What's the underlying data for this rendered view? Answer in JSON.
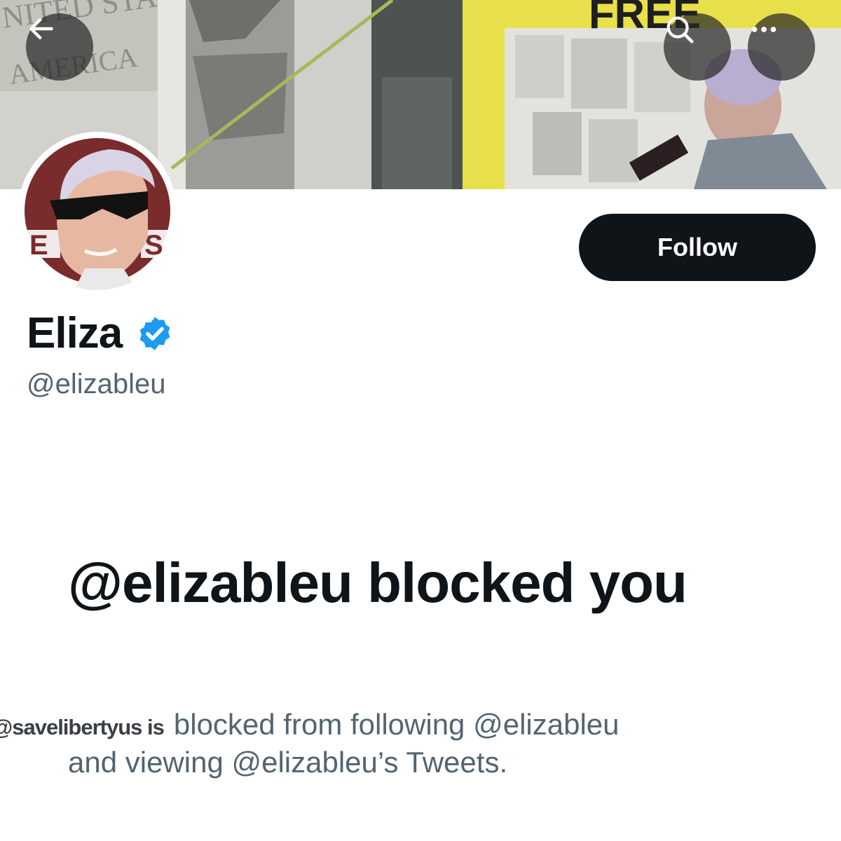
{
  "header": {
    "back_icon": "arrow-left-icon",
    "search_icon": "search-icon",
    "more_icon": "more-horizontal-icon",
    "banner_sign_text": "NITED STAT OF AMERICA",
    "banner_banner_text": "FREE"
  },
  "profile": {
    "display_name": "Eliza",
    "handle": "@elizableu",
    "verified": true,
    "verified_color": "#1d9bf0",
    "avatar_text": "E  S",
    "follow_label": "Follow"
  },
  "blocked": {
    "title": "@elizableu blocked you",
    "viewer_handle": "@savelibertyus is",
    "message_line1": "blocked from following @elizableu",
    "message_line2": "and viewing @elizableu’s Tweets."
  },
  "colors": {
    "text_primary": "#0f1419",
    "text_secondary": "#536471",
    "button_dark": "#0f1419"
  }
}
